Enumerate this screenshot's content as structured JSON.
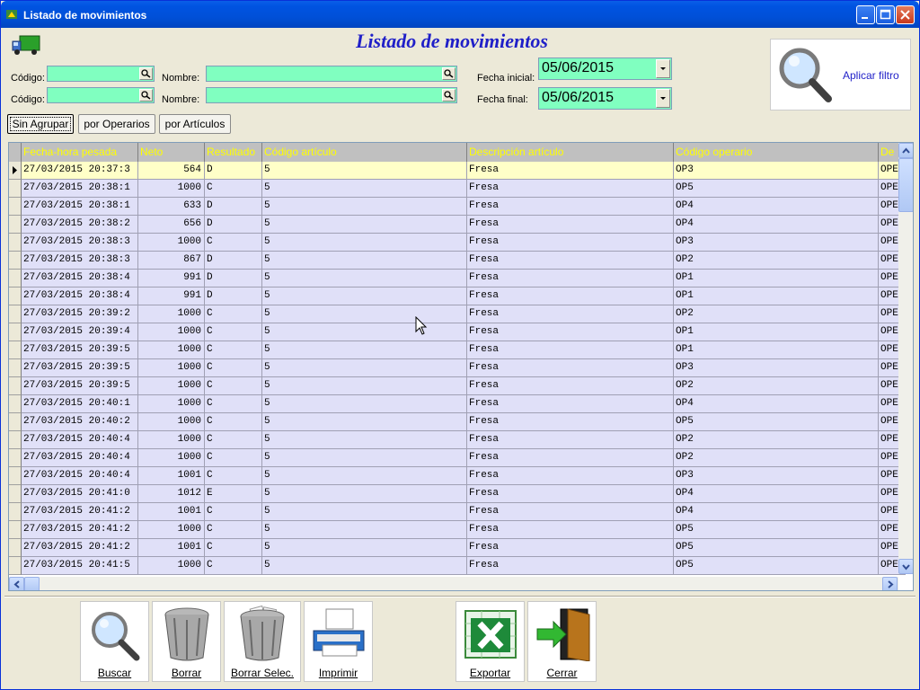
{
  "window": {
    "title": "Listado de movimientos"
  },
  "header": {
    "title": "Listado de movimientos"
  },
  "filters": {
    "codigo1_label": "Código:",
    "codigo2_label": "Código:",
    "nombre1_label": "Nombre:",
    "nombre2_label": "Nombre:",
    "fecha_inicial_label": "Fecha inicial:",
    "fecha_final_label": "Fecha final:",
    "fecha_inicial": "05/06/2015",
    "fecha_final": "05/06/2015",
    "aplicar_filtro": "Aplicar filtro"
  },
  "groupby": {
    "sin_agrupar": "Sin Agrupar",
    "por_operarios": "por Operarios",
    "por_articulos": "por Artículos"
  },
  "grid": {
    "columns": [
      "Fecha-hora pesada",
      "Neto",
      "Resultado",
      "Código artículo",
      "Descripción artículo",
      "Código operario",
      "De"
    ],
    "rows": [
      [
        "27/03/2015 20:37:3",
        "564",
        "D",
        "5",
        "Fresa",
        "OP3",
        "OPE"
      ],
      [
        "27/03/2015 20:38:1",
        "1000",
        "C",
        "5",
        "Fresa",
        "OP5",
        "OPE"
      ],
      [
        "27/03/2015 20:38:1",
        "633",
        "D",
        "5",
        "Fresa",
        "OP4",
        "OPE"
      ],
      [
        "27/03/2015 20:38:2",
        "656",
        "D",
        "5",
        "Fresa",
        "OP4",
        "OPE"
      ],
      [
        "27/03/2015 20:38:3",
        "1000",
        "C",
        "5",
        "Fresa",
        "OP3",
        "OPE"
      ],
      [
        "27/03/2015 20:38:3",
        "867",
        "D",
        "5",
        "Fresa",
        "OP2",
        "OPE"
      ],
      [
        "27/03/2015 20:38:4",
        "991",
        "D",
        "5",
        "Fresa",
        "OP1",
        "OPE"
      ],
      [
        "27/03/2015 20:38:4",
        "991",
        "D",
        "5",
        "Fresa",
        "OP1",
        "OPE"
      ],
      [
        "27/03/2015 20:39:2",
        "1000",
        "C",
        "5",
        "Fresa",
        "OP2",
        "OPE"
      ],
      [
        "27/03/2015 20:39:4",
        "1000",
        "C",
        "5",
        "Fresa",
        "OP1",
        "OPE"
      ],
      [
        "27/03/2015 20:39:5",
        "1000",
        "C",
        "5",
        "Fresa",
        "OP1",
        "OPE"
      ],
      [
        "27/03/2015 20:39:5",
        "1000",
        "C",
        "5",
        "Fresa",
        "OP3",
        "OPE"
      ],
      [
        "27/03/2015 20:39:5",
        "1000",
        "C",
        "5",
        "Fresa",
        "OP2",
        "OPE"
      ],
      [
        "27/03/2015 20:40:1",
        "1000",
        "C",
        "5",
        "Fresa",
        "OP4",
        "OPE"
      ],
      [
        "27/03/2015 20:40:2",
        "1000",
        "C",
        "5",
        "Fresa",
        "OP5",
        "OPE"
      ],
      [
        "27/03/2015 20:40:4",
        "1000",
        "C",
        "5",
        "Fresa",
        "OP2",
        "OPE"
      ],
      [
        "27/03/2015 20:40:4",
        "1000",
        "C",
        "5",
        "Fresa",
        "OP2",
        "OPE"
      ],
      [
        "27/03/2015 20:40:4",
        "1001",
        "C",
        "5",
        "Fresa",
        "OP3",
        "OPE"
      ],
      [
        "27/03/2015 20:41:0",
        "1012",
        "E",
        "5",
        "Fresa",
        "OP4",
        "OPE"
      ],
      [
        "27/03/2015 20:41:2",
        "1001",
        "C",
        "5",
        "Fresa",
        "OP4",
        "OPE"
      ],
      [
        "27/03/2015 20:41:2",
        "1000",
        "C",
        "5",
        "Fresa",
        "OP5",
        "OPE"
      ],
      [
        "27/03/2015 20:41:2",
        "1001",
        "C",
        "5",
        "Fresa",
        "OP5",
        "OPE"
      ],
      [
        "27/03/2015 20:41:5",
        "1000",
        "C",
        "5",
        "Fresa",
        "OP5",
        "OPE"
      ]
    ],
    "selected_row": 0,
    "colors": {
      "header_text": "#ffff00",
      "row_bg": "#e0e0f8",
      "selected_bg": "#ffffc8"
    }
  },
  "toolbar": {
    "buscar": "Buscar",
    "borrar": "Borrar",
    "borrar_selec": "Borrar Selec.",
    "imprimir": "Imprimir",
    "exportar": "Exportar",
    "cerrar": "Cerrar"
  }
}
